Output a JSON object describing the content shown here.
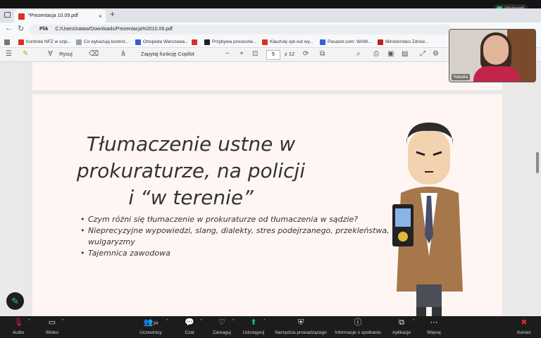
{
  "zoom_share": {
    "label": "Wyświetl"
  },
  "browser": {
    "tab_title": "*Prezentacja 10.09.pdf",
    "tab_close": "×",
    "new_tab": "+",
    "address_label": "Plik",
    "address_url": "C:/Users/nataw/Downloads/Prezentacja%2010.09.pdf",
    "bookmarks": [
      {
        "label": "Kontrole NFZ w szpi...",
        "color": "#d93025"
      },
      {
        "label": "Co wykazują kontrol...",
        "color": "#9aa0a6"
      },
      {
        "label": "Ortopeda Warszawa...",
        "color": "#3b5bdb"
      },
      {
        "label": "",
        "color": "#d93025"
      },
      {
        "label": "Przybywa procesów...",
        "color": "#202124"
      },
      {
        "label": "Klauzulę opt-out wy...",
        "color": "#d93025"
      },
      {
        "label": "Pasazer.com: WAW...",
        "color": "#3b5bdb"
      },
      {
        "label": "Ministerstwo Zdrow...",
        "color": "#c5221f"
      }
    ]
  },
  "pdf_toolbar": {
    "draw_label": "Rysuj",
    "copilot_label": "Zapytaj funkcję Copilot",
    "page_current": "5",
    "page_total": "z 12"
  },
  "slide": {
    "title": "Tłumaczenie ustne w\nprokuraturze, na policji\ni “w terenie”",
    "bullets": [
      "Czym różni się tłumaczenie w prokuraturze od tłumaczenia w sądzie?",
      "Nieprecyzyjne wypowiedzi, slang, dialekty, stres podejrzanego, przekleństwa, wulgaryzmy",
      "Tajemnica zawodowa"
    ]
  },
  "video": {
    "participant_name": "Natalia"
  },
  "zoom_bar": {
    "audio": "Audio",
    "video": "Wideo",
    "participants": "Uczestnicy",
    "participants_count": "24",
    "chat": "Czat",
    "react": "Zareaguj",
    "share": "Udostępnij",
    "host_tools": "Narzędzia prowadzącego",
    "meeting_info": "Informacje o spotkaniu",
    "apps": "Aplikacje",
    "more": "Więcej",
    "end": "Koniec"
  },
  "colors": {
    "accent_green": "#20c46a",
    "end_red": "#e0243a",
    "slide_bg": "#fff6f3"
  },
  "icons": [
    "mic-muted-icon",
    "camera-icon",
    "participants-icon",
    "chat-icon",
    "heart-icon",
    "share-screen-icon",
    "shield-icon",
    "info-icon",
    "apps-icon",
    "more-icon",
    "close-icon",
    "pen-icon"
  ]
}
